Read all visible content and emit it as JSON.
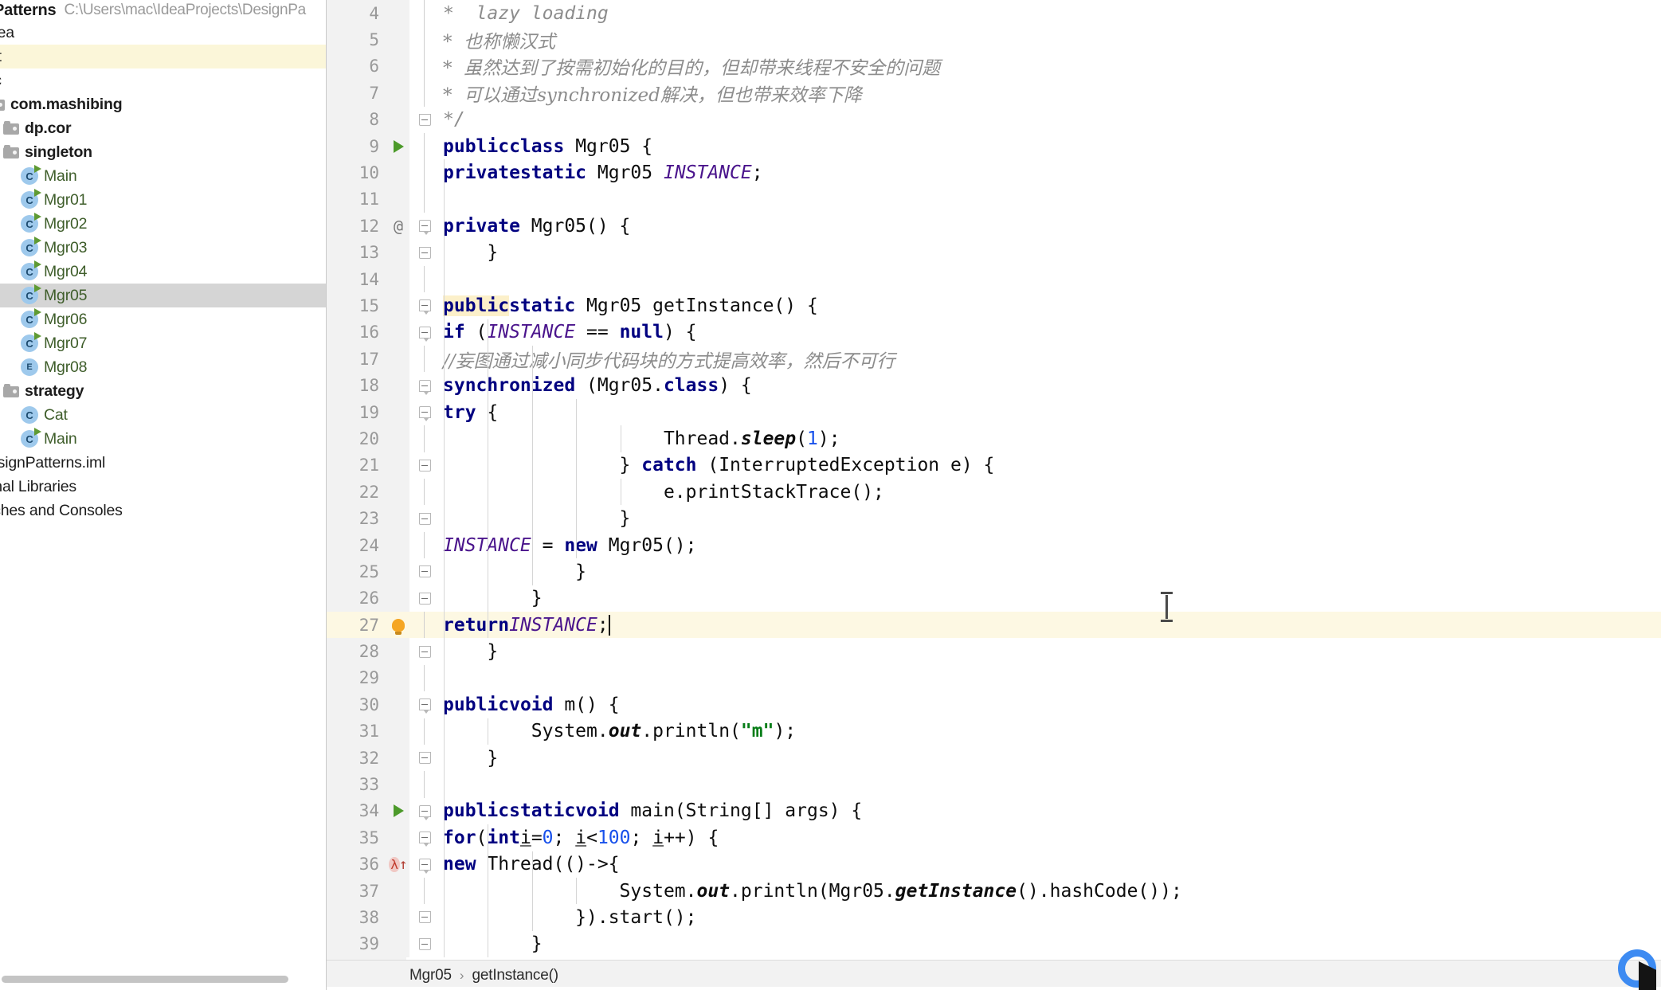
{
  "project": {
    "name": "gnPatterns",
    "path": "C:\\Users\\mac\\IdeaProjects\\DesignPa",
    "tree": [
      {
        "label": "dea",
        "indent": 1,
        "twisty": "",
        "icon": "none",
        "state": "normal"
      },
      {
        "label": "ut",
        "indent": 1,
        "twisty": "",
        "icon": "none",
        "state": "highlight"
      },
      {
        "label": "rc",
        "indent": 1,
        "twisty": "",
        "icon": "none",
        "state": "normal"
      },
      {
        "label": "com.mashibing",
        "indent": 1,
        "twisty": "",
        "icon": "folder",
        "state": "normal"
      },
      {
        "label": "dp.cor",
        "indent": 2,
        "twisty": "›",
        "icon": "folder",
        "state": "normal"
      },
      {
        "label": "singleton",
        "indent": 2,
        "twisty": "⌄",
        "icon": "folder",
        "state": "normal"
      },
      {
        "label": "Main",
        "indent": 3,
        "twisty": "",
        "icon": "class-run",
        "state": "normal"
      },
      {
        "label": "Mgr01",
        "indent": 3,
        "twisty": "",
        "icon": "class-run",
        "state": "normal"
      },
      {
        "label": "Mgr02",
        "indent": 3,
        "twisty": "",
        "icon": "class-run",
        "state": "normal"
      },
      {
        "label": "Mgr03",
        "indent": 3,
        "twisty": "",
        "icon": "class-run",
        "state": "normal"
      },
      {
        "label": "Mgr04",
        "indent": 3,
        "twisty": "",
        "icon": "class-run",
        "state": "normal"
      },
      {
        "label": "Mgr05",
        "indent": 3,
        "twisty": "",
        "icon": "class-run",
        "state": "selected"
      },
      {
        "label": "Mgr06",
        "indent": 3,
        "twisty": "",
        "icon": "class-run",
        "state": "normal"
      },
      {
        "label": "Mgr07",
        "indent": 3,
        "twisty": "",
        "icon": "class-run",
        "state": "normal"
      },
      {
        "label": "Mgr08",
        "indent": 3,
        "twisty": "",
        "icon": "enum",
        "state": "normal"
      },
      {
        "label": "strategy",
        "indent": 2,
        "twisty": "⌄",
        "icon": "folder",
        "state": "normal"
      },
      {
        "label": "Cat",
        "indent": 3,
        "twisty": "",
        "icon": "class",
        "state": "normal"
      },
      {
        "label": "Main",
        "indent": 3,
        "twisty": "",
        "icon": "class-run",
        "state": "normal"
      },
      {
        "label": "esignPatterns.iml",
        "indent": 1,
        "twisty": "",
        "icon": "none",
        "state": "normal"
      },
      {
        "label": "rnal Libraries",
        "indent": 1,
        "twisty": "",
        "icon": "none",
        "state": "normal"
      },
      {
        "label": "tches and Consoles",
        "indent": 1,
        "twisty": "",
        "icon": "none",
        "state": "normal"
      }
    ]
  },
  "editor": {
    "file": "Mgr05",
    "caret_line": 27,
    "lines": [
      {
        "n": "4",
        "gutter": "",
        "fold": "",
        "text": " *  lazy loading"
      },
      {
        "n": "5",
        "gutter": "",
        "fold": "",
        "text": " *  也称懒汉式"
      },
      {
        "n": "6",
        "gutter": "",
        "fold": "",
        "text": " *  虽然达到了按需初始化的目的，但却带来线程不安全的问题"
      },
      {
        "n": "7",
        "gutter": "",
        "fold": "",
        "text": " *  可以通过synchronized解决，但也带来效率下降"
      },
      {
        "n": "8",
        "gutter": "",
        "fold": "bot",
        "text": " */"
      },
      {
        "n": "9",
        "gutter": "run",
        "fold": "",
        "text": "public class Mgr05 {"
      },
      {
        "n": "10",
        "gutter": "",
        "fold": "",
        "text": "    private static Mgr05 INSTANCE;"
      },
      {
        "n": "11",
        "gutter": "",
        "fold": "",
        "text": ""
      },
      {
        "n": "12",
        "gutter": "at",
        "fold": "top",
        "text": "    private Mgr05() {"
      },
      {
        "n": "13",
        "gutter": "",
        "fold": "bot",
        "text": "    }"
      },
      {
        "n": "14",
        "gutter": "",
        "fold": "",
        "text": ""
      },
      {
        "n": "15",
        "gutter": "",
        "fold": "top",
        "text": "    public static Mgr05 getInstance() {"
      },
      {
        "n": "16",
        "gutter": "",
        "fold": "top",
        "text": "        if (INSTANCE == null) {"
      },
      {
        "n": "17",
        "gutter": "",
        "fold": "",
        "text": "            //妄图通过减小同步代码块的方式提高效率，然后不可行"
      },
      {
        "n": "18",
        "gutter": "",
        "fold": "top",
        "text": "            synchronized (Mgr05.class) {"
      },
      {
        "n": "19",
        "gutter": "",
        "fold": "top",
        "text": "                try {"
      },
      {
        "n": "20",
        "gutter": "",
        "fold": "",
        "text": "                    Thread.sleep(1);"
      },
      {
        "n": "21",
        "gutter": "",
        "fold": "bot",
        "text": "                } catch (InterruptedException e) {"
      },
      {
        "n": "22",
        "gutter": "",
        "fold": "",
        "text": "                    e.printStackTrace();"
      },
      {
        "n": "23",
        "gutter": "",
        "fold": "bot",
        "text": "                }"
      },
      {
        "n": "24",
        "gutter": "",
        "fold": "",
        "text": "                INSTANCE = new Mgr05();"
      },
      {
        "n": "25",
        "gutter": "",
        "fold": "bot",
        "text": "            }"
      },
      {
        "n": "26",
        "gutter": "",
        "fold": "bot",
        "text": "        }"
      },
      {
        "n": "27",
        "gutter": "bulb",
        "fold": "",
        "text": "        return INSTANCE;"
      },
      {
        "n": "28",
        "gutter": "",
        "fold": "bot",
        "text": "    }"
      },
      {
        "n": "29",
        "gutter": "",
        "fold": "",
        "text": ""
      },
      {
        "n": "30",
        "gutter": "",
        "fold": "top",
        "text": "    public void m() {"
      },
      {
        "n": "31",
        "gutter": "",
        "fold": "",
        "text": "        System.out.println(\"m\");"
      },
      {
        "n": "32",
        "gutter": "",
        "fold": "bot",
        "text": "    }"
      },
      {
        "n": "33",
        "gutter": "",
        "fold": "",
        "text": ""
      },
      {
        "n": "34",
        "gutter": "run",
        "fold": "top",
        "text": "    public static void main(String[] args) {"
      },
      {
        "n": "35",
        "gutter": "",
        "fold": "top",
        "text": "        for(int i=0; i<100; i++) {"
      },
      {
        "n": "36",
        "gutter": "lam",
        "fold": "top",
        "text": "            new Thread(()->{"
      },
      {
        "n": "37",
        "gutter": "",
        "fold": "",
        "text": "                System.out.println(Mgr05.getInstance().hashCode());"
      },
      {
        "n": "38",
        "gutter": "",
        "fold": "bot",
        "text": "            }).start();"
      },
      {
        "n": "39",
        "gutter": "",
        "fold": "bot",
        "text": "        }"
      }
    ]
  },
  "status_bar": {
    "breadcrumb": [
      "Mgr05",
      "getInstance()"
    ],
    "separator": "›"
  },
  "colors": {
    "keyword": "#000080",
    "field": "#4a148c",
    "string": "#067d17",
    "number": "#1750eb",
    "comment": "#8c8c8c",
    "current_line": "#fdf8e3",
    "selection": "#d5d5d5",
    "accent_cursor": "#3d8bf2"
  }
}
